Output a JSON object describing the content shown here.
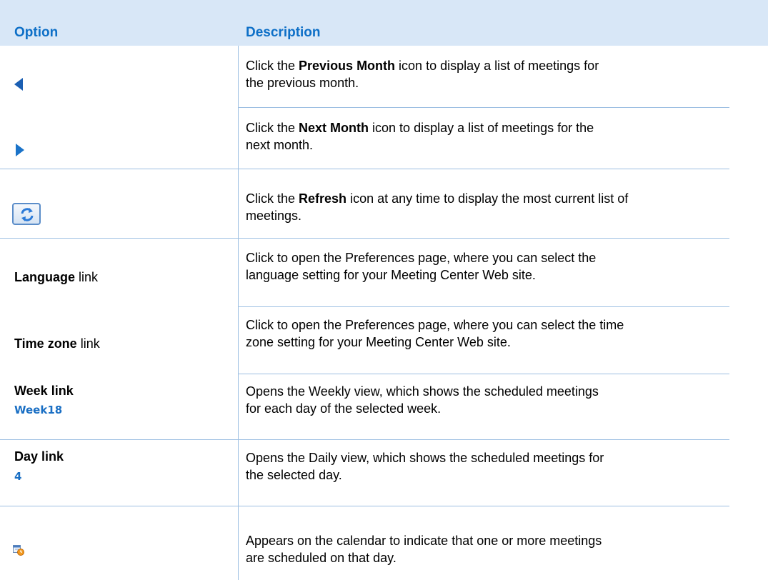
{
  "header": {
    "option_label": "Option",
    "description_label": "Description"
  },
  "rows": [
    {
      "option_icon": "previous-month-arrow-icon",
      "desc_pre": "Click the ",
      "desc_bold": "Previous Month",
      "desc_line1_post": " icon to display a list of meetings for",
      "desc_line2": "the previous month."
    },
    {
      "option_icon": "next-month-arrow-icon",
      "desc_pre": "Click the ",
      "desc_bold": "Next Month",
      "desc_line1_post": " icon to display a list of meetings for the",
      "desc_line2": "next month."
    },
    {
      "option_icon": "refresh-icon",
      "desc_pre": "Click the ",
      "desc_bold": "Refresh",
      "desc_line1_post": " icon at any time to display the most current list of",
      "desc_line2": "meetings."
    },
    {
      "option_bold": "Language",
      "option_post": " link",
      "desc_line1": "Click to open the Preferences page, where you can select the",
      "desc_line2": "language setting for your Meeting Center Web site."
    },
    {
      "option_bold": "Time zone",
      "option_post": " link",
      "desc_line1": "Click to open the Preferences page, where you can select the time",
      "desc_line2": "zone setting for your Meeting Center Web site."
    },
    {
      "option_bold": "Week link",
      "option_example": "Week18",
      "desc_line1": "Opens the Weekly view, which shows the scheduled meetings",
      "desc_line2": "for each day of the selected week."
    },
    {
      "option_bold": "Day link",
      "option_example": "4",
      "desc_line1": "Opens the Daily view, which shows the scheduled meetings for",
      "desc_line2": "the selected day."
    },
    {
      "option_icon": "meeting-scheduled-calendar-icon",
      "desc_line1": "Appears on the calendar to indicate that one or more meetings",
      "desc_line2": "are scheduled on that day."
    }
  ],
  "colors": {
    "header_bg": "#d8e7f7",
    "header_text": "#0d6fc7",
    "rule": "#9dbfe2",
    "link": "#1a6fc4"
  }
}
